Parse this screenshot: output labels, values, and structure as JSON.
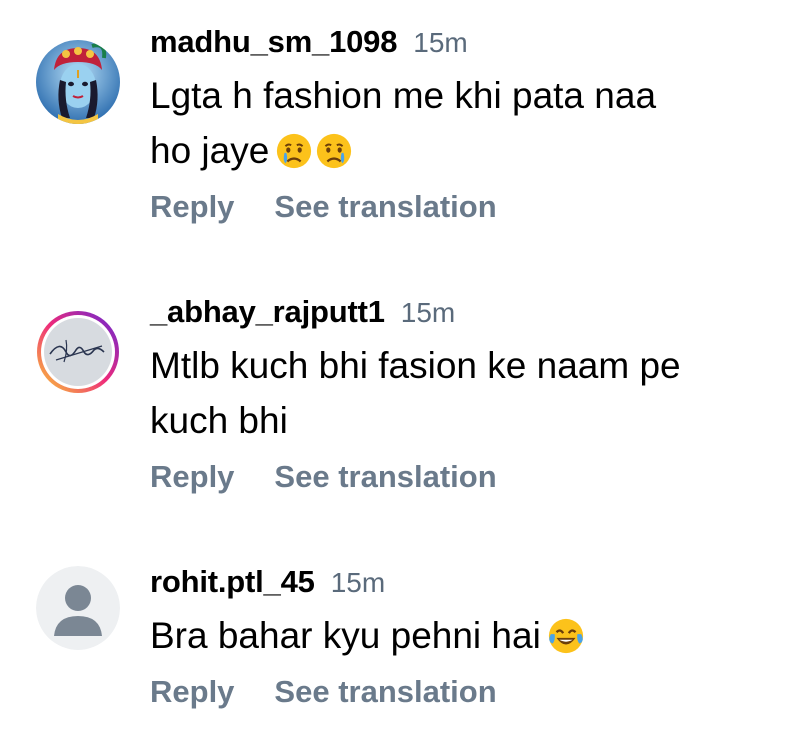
{
  "comments": [
    {
      "username": "madhu_sm_1098",
      "time": "15m",
      "text_line1": "Lgta h fashion me khi pata naa",
      "text_line2": "ho jaye",
      "emojis": [
        "crying-face",
        "crying-face"
      ],
      "reply_label": "Reply",
      "translate_label": "See translation"
    },
    {
      "username": "_abhay_rajputt1",
      "time": "15m",
      "text_line1": "Mtlb kuch bhi fasion ke naam pe",
      "text_line2": "kuch bhi",
      "reply_label": "Reply",
      "translate_label": "See translation"
    },
    {
      "username": "rohit.ptl_45",
      "time": "15m",
      "text_line1": "Bra bahar kyu pehni hai",
      "emojis": [
        "tears-of-joy-face"
      ],
      "reply_label": "Reply",
      "translate_label": "See translation"
    }
  ],
  "colors": {
    "time": "#5a6a7b",
    "action": "#6a7a8b",
    "story_ring_start": "#f9ce34",
    "story_ring_mid": "#ee2a7b",
    "story_ring_end": "#6228d7"
  }
}
